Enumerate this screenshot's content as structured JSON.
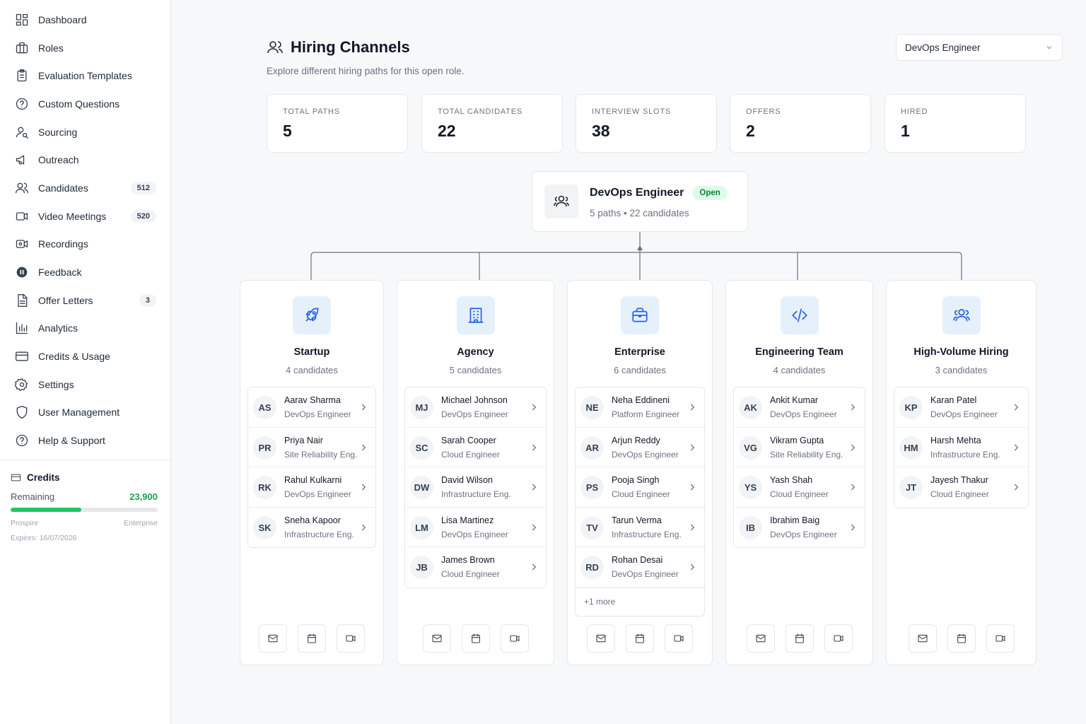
{
  "sidebar": {
    "items": [
      {
        "label": "Dashboard",
        "icon": "dashboard-icon"
      },
      {
        "label": "Roles",
        "icon": "briefcase-icon"
      },
      {
        "label": "Evaluation Templates",
        "icon": "clipboard-icon"
      },
      {
        "label": "Custom Questions",
        "icon": "question-icon"
      },
      {
        "label": "Sourcing",
        "icon": "user-search-icon"
      },
      {
        "label": "Outreach",
        "icon": "megaphone-icon"
      },
      {
        "label": "Candidates",
        "icon": "users-icon",
        "badge": "512"
      },
      {
        "label": "Video Meetings",
        "icon": "video-icon",
        "badge": "520"
      },
      {
        "label": "Recordings",
        "icon": "recording-icon"
      },
      {
        "label": "Feedback",
        "icon": "feedback-icon"
      },
      {
        "label": "Offer Letters",
        "icon": "document-icon",
        "badge": "3"
      },
      {
        "label": "Analytics",
        "icon": "chart-icon"
      },
      {
        "label": "Credits & Usage",
        "icon": "credit-card-icon"
      },
      {
        "label": "Settings",
        "icon": "gear-icon"
      },
      {
        "label": "User Management",
        "icon": "shield-icon"
      },
      {
        "label": "Help & Support",
        "icon": "help-icon"
      }
    ],
    "credits": {
      "title": "Credits",
      "remaining_label": "Remaining",
      "remaining_value": "23,900",
      "progress_fraction": 0.48,
      "plan_left": "Prospire",
      "plan_right": "Enterprise",
      "expires": "Expires: 16/07/2026",
      "bar_color": "#22c55e"
    }
  },
  "header": {
    "title": "Hiring Channels",
    "subtitle": "Explore different hiring paths for this open role.",
    "role_select": "DevOps Engineer"
  },
  "stats": [
    {
      "label": "TOTAL PATHS",
      "value": "5"
    },
    {
      "label": "TOTAL CANDIDATES",
      "value": "22"
    },
    {
      "label": "INTERVIEW SLOTS",
      "value": "38"
    },
    {
      "label": "OFFERS",
      "value": "2"
    },
    {
      "label": "HIRED",
      "value": "1"
    }
  ],
  "root": {
    "title": "DevOps Engineer",
    "status": "Open",
    "meta": "5 paths • 22 candidates"
  },
  "channels": [
    {
      "name": "Startup",
      "count": "4 candidates",
      "icon": "rocket-icon",
      "candidates": [
        {
          "initials": "AS",
          "name": "Aarav Sharma",
          "role": "DevOps Engineer"
        },
        {
          "initials": "PR",
          "name": "Priya Nair",
          "role": "Site Reliability Eng."
        },
        {
          "initials": "RK",
          "name": "Rahul Kulkarni",
          "role": "DevOps Engineer"
        },
        {
          "initials": "SK",
          "name": "Sneha Kapoor",
          "role": "Infrastructure Eng."
        }
      ]
    },
    {
      "name": "Agency",
      "count": "5 candidates",
      "icon": "building-icon",
      "candidates": [
        {
          "initials": "MJ",
          "name": "Michael Johnson",
          "role": "DevOps Engineer"
        },
        {
          "initials": "SC",
          "name": "Sarah Cooper",
          "role": "Cloud Engineer"
        },
        {
          "initials": "DW",
          "name": "David Wilson",
          "role": "Infrastructure Eng."
        },
        {
          "initials": "LM",
          "name": "Lisa Martinez",
          "role": "DevOps Engineer"
        },
        {
          "initials": "JB",
          "name": "James Brown",
          "role": "Cloud Engineer"
        }
      ]
    },
    {
      "name": "Enterprise",
      "count": "6 candidates",
      "icon": "briefcase-icon",
      "candidates": [
        {
          "initials": "NE",
          "name": "Neha Eddineni",
          "role": "Platform Engineer"
        },
        {
          "initials": "AR",
          "name": "Arjun Reddy",
          "role": "DevOps Engineer"
        },
        {
          "initials": "PS",
          "name": "Pooja Singh",
          "role": "Cloud Engineer"
        },
        {
          "initials": "TV",
          "name": "Tarun Verma",
          "role": "Infrastructure Eng."
        },
        {
          "initials": "RD",
          "name": "Rohan Desai",
          "role": "DevOps Engineer"
        }
      ],
      "more": "+1 more"
    },
    {
      "name": "Engineering Team",
      "count": "4 candidates",
      "icon": "code-icon",
      "candidates": [
        {
          "initials": "AK",
          "name": "Ankit Kumar",
          "role": "DevOps Engineer"
        },
        {
          "initials": "VG",
          "name": "Vikram Gupta",
          "role": "Site Reliability Eng."
        },
        {
          "initials": "YS",
          "name": "Yash Shah",
          "role": "Cloud Engineer"
        },
        {
          "initials": "IB",
          "name": "Ibrahim Baig",
          "role": "DevOps Engineer"
        }
      ]
    },
    {
      "name": "High-Volume Hiring",
      "count": "3 candidates",
      "icon": "users-icon",
      "candidates": [
        {
          "initials": "KP",
          "name": "Karan Patel",
          "role": "DevOps Engineer"
        },
        {
          "initials": "HM",
          "name": "Harsh Mehta",
          "role": "Infrastructure Eng."
        },
        {
          "initials": "JT",
          "name": "Jayesh Thakur",
          "role": "Cloud Engineer"
        }
      ]
    }
  ],
  "colors": {
    "accent": "#2563eb",
    "icon_bg": "#e6f0fb",
    "status_open_bg": "#dcfce7",
    "status_open_text": "#15803d"
  }
}
